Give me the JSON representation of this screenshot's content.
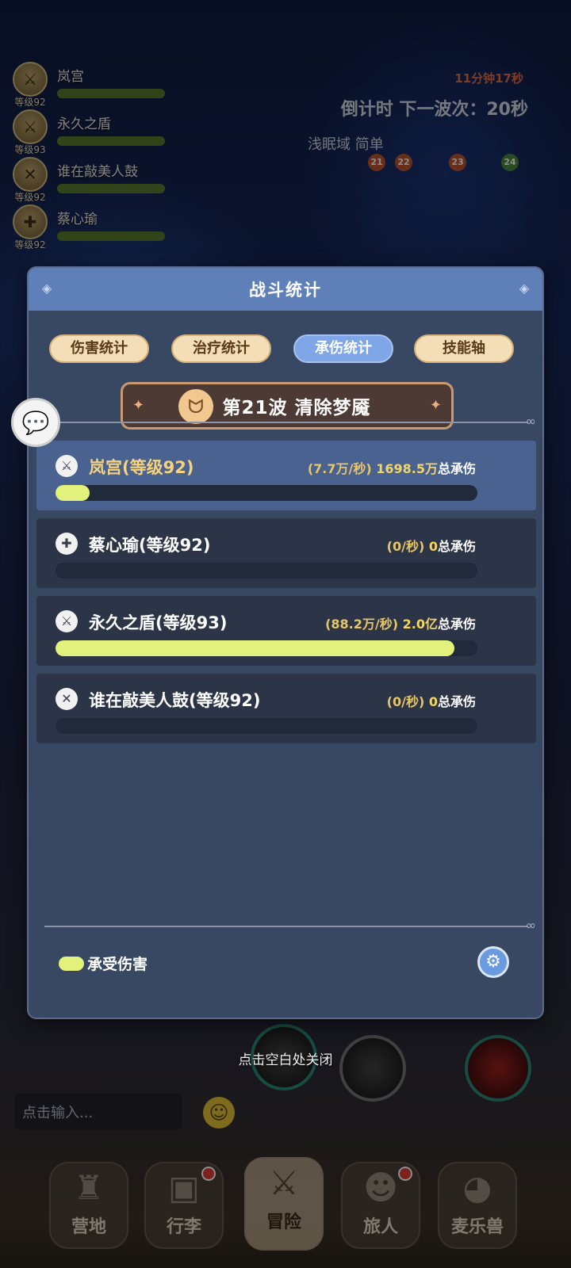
{
  "team": [
    {
      "name": "岚宫",
      "level": "等级92",
      "icon": "sword-icon"
    },
    {
      "name": "永久之盾",
      "level": "等级93",
      "icon": "sword-icon"
    },
    {
      "name": "谁在敲美人鼓",
      "level": "等级92",
      "icon": "crossed-swords-icon"
    },
    {
      "name": "蔡心瑜",
      "level": "等级92",
      "icon": "cross-icon"
    }
  ],
  "hud": {
    "total_time": "11分钟17秒",
    "countdown": "倒计时 下一波次：20秒",
    "zone": "浅眠域  简单",
    "waves": [
      "21",
      "22",
      "23",
      "24"
    ]
  },
  "modal": {
    "title": "战斗统计",
    "tabs": [
      "伤害统计",
      "治疗统计",
      "承伤统计",
      "技能轴"
    ],
    "active_tab": "承伤统计",
    "wave_label": "第21波  清除梦魇",
    "rows": [
      {
        "name": "岚宫(等级92)",
        "rate": "(7.7万/秒)",
        "total": "1698.5万",
        "suffix": "总承伤",
        "fraction": 0.08,
        "icon": "sword-icon",
        "selected": true
      },
      {
        "name": "蔡心瑜(等级92)",
        "rate": "(0/秒)",
        "total": "0",
        "suffix": "总承伤",
        "fraction": 0.0,
        "icon": "cross-icon",
        "selected": false
      },
      {
        "name": "永久之盾(等级93)",
        "rate": "(88.2万/秒)",
        "total": "2.0亿",
        "suffix": "总承伤",
        "fraction": 0.945,
        "icon": "sword-icon",
        "selected": false
      },
      {
        "name": "谁在敲美人鼓(等级92)",
        "rate": "(0/秒)",
        "total": "0",
        "suffix": "总承伤",
        "fraction": 0.0,
        "icon": "crossed-swords-icon",
        "selected": false
      }
    ],
    "legend_label": "承受伤害",
    "bar_color": "#e2f07c"
  },
  "close_hint": "点击空白处关闭",
  "chat": {
    "placeholder": "点击输入..."
  },
  "nav": [
    {
      "label": "营地",
      "icon": "castle-icon",
      "badge": false,
      "active": false
    },
    {
      "label": "行李",
      "icon": "chest-icon",
      "badge": true,
      "active": false
    },
    {
      "label": "冒险",
      "icon": "crossed-swords-icon",
      "badge": false,
      "active": true
    },
    {
      "label": "旅人",
      "icon": "character-icon",
      "badge": true,
      "active": false
    },
    {
      "label": "麦乐兽",
      "icon": "pet-icon",
      "badge": false,
      "active": false
    }
  ]
}
